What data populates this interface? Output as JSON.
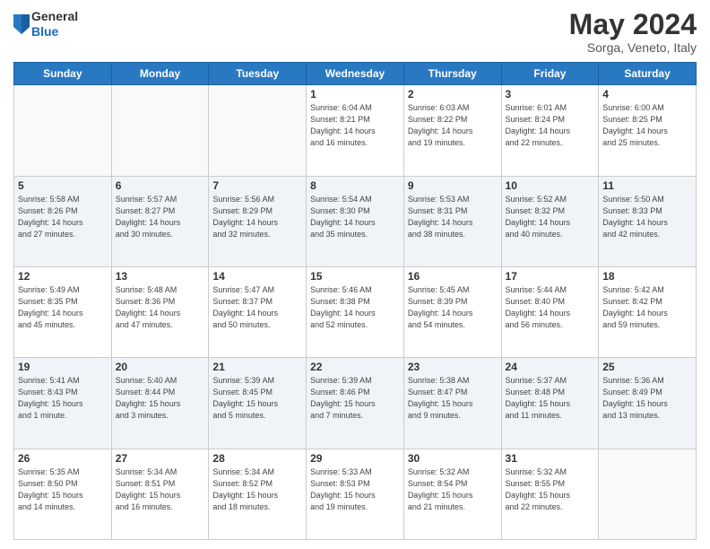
{
  "header": {
    "logo_general": "General",
    "logo_blue": "Blue",
    "month_title": "May 2024",
    "location": "Sorga, Veneto, Italy"
  },
  "weekdays": [
    "Sunday",
    "Monday",
    "Tuesday",
    "Wednesday",
    "Thursday",
    "Friday",
    "Saturday"
  ],
  "weeks": [
    [
      {
        "day": "",
        "info": ""
      },
      {
        "day": "",
        "info": ""
      },
      {
        "day": "",
        "info": ""
      },
      {
        "day": "1",
        "info": "Sunrise: 6:04 AM\nSunset: 8:21 PM\nDaylight: 14 hours\nand 16 minutes."
      },
      {
        "day": "2",
        "info": "Sunrise: 6:03 AM\nSunset: 8:22 PM\nDaylight: 14 hours\nand 19 minutes."
      },
      {
        "day": "3",
        "info": "Sunrise: 6:01 AM\nSunset: 8:24 PM\nDaylight: 14 hours\nand 22 minutes."
      },
      {
        "day": "4",
        "info": "Sunrise: 6:00 AM\nSunset: 8:25 PM\nDaylight: 14 hours\nand 25 minutes."
      }
    ],
    [
      {
        "day": "5",
        "info": "Sunrise: 5:58 AM\nSunset: 8:26 PM\nDaylight: 14 hours\nand 27 minutes."
      },
      {
        "day": "6",
        "info": "Sunrise: 5:57 AM\nSunset: 8:27 PM\nDaylight: 14 hours\nand 30 minutes."
      },
      {
        "day": "7",
        "info": "Sunrise: 5:56 AM\nSunset: 8:29 PM\nDaylight: 14 hours\nand 32 minutes."
      },
      {
        "day": "8",
        "info": "Sunrise: 5:54 AM\nSunset: 8:30 PM\nDaylight: 14 hours\nand 35 minutes."
      },
      {
        "day": "9",
        "info": "Sunrise: 5:53 AM\nSunset: 8:31 PM\nDaylight: 14 hours\nand 38 minutes."
      },
      {
        "day": "10",
        "info": "Sunrise: 5:52 AM\nSunset: 8:32 PM\nDaylight: 14 hours\nand 40 minutes."
      },
      {
        "day": "11",
        "info": "Sunrise: 5:50 AM\nSunset: 8:33 PM\nDaylight: 14 hours\nand 42 minutes."
      }
    ],
    [
      {
        "day": "12",
        "info": "Sunrise: 5:49 AM\nSunset: 8:35 PM\nDaylight: 14 hours\nand 45 minutes."
      },
      {
        "day": "13",
        "info": "Sunrise: 5:48 AM\nSunset: 8:36 PM\nDaylight: 14 hours\nand 47 minutes."
      },
      {
        "day": "14",
        "info": "Sunrise: 5:47 AM\nSunset: 8:37 PM\nDaylight: 14 hours\nand 50 minutes."
      },
      {
        "day": "15",
        "info": "Sunrise: 5:46 AM\nSunset: 8:38 PM\nDaylight: 14 hours\nand 52 minutes."
      },
      {
        "day": "16",
        "info": "Sunrise: 5:45 AM\nSunset: 8:39 PM\nDaylight: 14 hours\nand 54 minutes."
      },
      {
        "day": "17",
        "info": "Sunrise: 5:44 AM\nSunset: 8:40 PM\nDaylight: 14 hours\nand 56 minutes."
      },
      {
        "day": "18",
        "info": "Sunrise: 5:42 AM\nSunset: 8:42 PM\nDaylight: 14 hours\nand 59 minutes."
      }
    ],
    [
      {
        "day": "19",
        "info": "Sunrise: 5:41 AM\nSunset: 8:43 PM\nDaylight: 15 hours\nand 1 minute."
      },
      {
        "day": "20",
        "info": "Sunrise: 5:40 AM\nSunset: 8:44 PM\nDaylight: 15 hours\nand 3 minutes."
      },
      {
        "day": "21",
        "info": "Sunrise: 5:39 AM\nSunset: 8:45 PM\nDaylight: 15 hours\nand 5 minutes."
      },
      {
        "day": "22",
        "info": "Sunrise: 5:39 AM\nSunset: 8:46 PM\nDaylight: 15 hours\nand 7 minutes."
      },
      {
        "day": "23",
        "info": "Sunrise: 5:38 AM\nSunset: 8:47 PM\nDaylight: 15 hours\nand 9 minutes."
      },
      {
        "day": "24",
        "info": "Sunrise: 5:37 AM\nSunset: 8:48 PM\nDaylight: 15 hours\nand 11 minutes."
      },
      {
        "day": "25",
        "info": "Sunrise: 5:36 AM\nSunset: 8:49 PM\nDaylight: 15 hours\nand 13 minutes."
      }
    ],
    [
      {
        "day": "26",
        "info": "Sunrise: 5:35 AM\nSunset: 8:50 PM\nDaylight: 15 hours\nand 14 minutes."
      },
      {
        "day": "27",
        "info": "Sunrise: 5:34 AM\nSunset: 8:51 PM\nDaylight: 15 hours\nand 16 minutes."
      },
      {
        "day": "28",
        "info": "Sunrise: 5:34 AM\nSunset: 8:52 PM\nDaylight: 15 hours\nand 18 minutes."
      },
      {
        "day": "29",
        "info": "Sunrise: 5:33 AM\nSunset: 8:53 PM\nDaylight: 15 hours\nand 19 minutes."
      },
      {
        "day": "30",
        "info": "Sunrise: 5:32 AM\nSunset: 8:54 PM\nDaylight: 15 hours\nand 21 minutes."
      },
      {
        "day": "31",
        "info": "Sunrise: 5:32 AM\nSunset: 8:55 PM\nDaylight: 15 hours\nand 22 minutes."
      },
      {
        "day": "",
        "info": ""
      }
    ]
  ]
}
